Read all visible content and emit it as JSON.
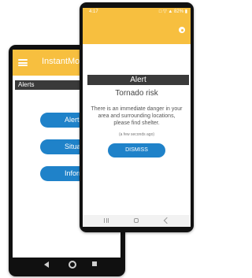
{
  "back_phone": {
    "app_title": "InstantMo",
    "section_label": "Alerts",
    "buttons": [
      "Alert",
      "Situation",
      "Information"
    ]
  },
  "front_phone": {
    "status_time": "4:17",
    "status_icons": "□ ▽ ▲ 82% ▮",
    "alert_title": "Alert",
    "headline": "Tornado risk",
    "message": "There is an immediate danger in your area and surrounding locations, please find shelter.",
    "timestamp": "(a few seconds ago)",
    "dismiss_label": "DISMISS"
  },
  "colors": {
    "accent_yellow": "#f7bf3f",
    "button_blue": "#1f82c9",
    "header_dark": "#3a3a3a"
  }
}
